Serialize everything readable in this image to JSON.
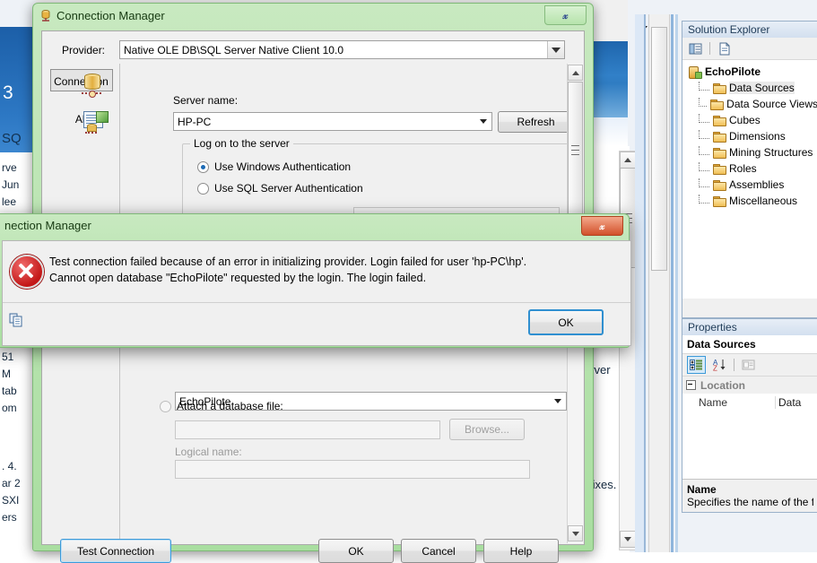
{
  "background": {
    "tabbar": {
      "dropdown_icon": "chevron-down-icon",
      "close_icon": "close-icon"
    },
    "fragments": [
      {
        "text": "3"
      },
      {
        "text": "SQ"
      },
      {
        "text": "rve"
      },
      {
        "text": "Jun"
      },
      {
        "text": "lee"
      },
      {
        "text": "51"
      },
      {
        "text": "M"
      },
      {
        "text": "tab"
      },
      {
        "text": "om"
      },
      {
        "text": ". 4."
      },
      {
        "text": "ar 2"
      },
      {
        "text": "SXI"
      },
      {
        "text": "ers"
      },
      {
        "text": "erver"
      },
      {
        "text": "fixes."
      }
    ]
  },
  "solution_explorer": {
    "title": "Solution Explorer",
    "toolbar": [
      {
        "name": "properties-window-icon"
      },
      {
        "name": "show-all-files-icon"
      }
    ],
    "project": {
      "label": "EchoPilote",
      "icon": "project-icon"
    },
    "nodes": [
      {
        "label": "Data Sources",
        "icon": "folder-icon",
        "selected": true
      },
      {
        "label": "Data Source Views",
        "icon": "folder-icon",
        "selected": false
      },
      {
        "label": "Cubes",
        "icon": "folder-icon",
        "selected": false
      },
      {
        "label": "Dimensions",
        "icon": "folder-icon",
        "selected": false
      },
      {
        "label": "Mining Structures",
        "icon": "folder-icon",
        "selected": false
      },
      {
        "label": "Roles",
        "icon": "folder-icon",
        "selected": false
      },
      {
        "label": "Assemblies",
        "icon": "folder-icon",
        "selected": false
      },
      {
        "label": "Miscellaneous",
        "icon": "folder-icon",
        "selected": false
      }
    ]
  },
  "properties": {
    "title": "Properties",
    "object_name": "Data Sources",
    "toolbar": [
      {
        "name": "categorized-view-icon",
        "selected": true
      },
      {
        "name": "alphabetical-sort-icon",
        "selected": false
      },
      {
        "name": "property-pages-icon",
        "selected": false
      }
    ],
    "category": "Location",
    "rows": [
      {
        "name": "Name",
        "value": "Data"
      }
    ],
    "help": {
      "title": "Name",
      "description": "Specifies the name of the f"
    }
  },
  "connection_manager": {
    "title": "Connection Manager",
    "title_icon": "connection-icon",
    "close_icon": "close-icon",
    "provider": {
      "label": "Provider:",
      "value": "Native OLE DB\\SQL Server Native Client 10.0"
    },
    "sidebar": [
      {
        "label": "Connection",
        "icon": "database-icon",
        "selected": true
      },
      {
        "label": "All",
        "icon": "all-properties-icon",
        "selected": false
      }
    ],
    "server": {
      "label": "Server name:",
      "value": "HP-PC",
      "refresh_label": "Refresh"
    },
    "logon_group": {
      "title": "Log on to the server",
      "options": [
        {
          "label": "Use Windows Authentication",
          "selected": true
        },
        {
          "label": "Use SQL Server Authentication",
          "selected": false
        }
      ]
    },
    "database": {
      "select_value": "EchoPilote",
      "attach_label": "Attach a database file:",
      "attach_selected": false,
      "attach_value": "",
      "browse_label": "Browse...",
      "logical_label": "Logical name:",
      "logical_value": ""
    },
    "buttons": {
      "test_connection": "Test Connection",
      "ok": "OK",
      "cancel": "Cancel",
      "help": "Help"
    }
  },
  "error_dialog": {
    "title": "nection Manager",
    "close_icon": "close-icon",
    "icon": "error-icon",
    "copy_icon": "copy-to-clipboard-icon",
    "message_line1": "Test connection failed because of an error in initializing provider. Login failed for user 'hp-PC\\hp'.",
    "message_line2": "Cannot open database \"EchoPilote\" requested by the login. The login failed.",
    "ok_label": "OK"
  }
}
